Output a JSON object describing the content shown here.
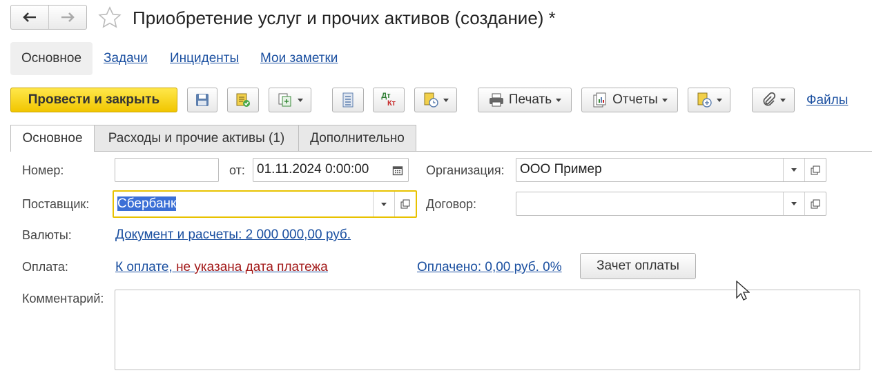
{
  "window": {
    "title": "Приобретение услуг и прочих активов (создание) *"
  },
  "nav": {
    "back_icon": "arrow-left-icon",
    "forward_icon": "arrow-right-icon",
    "favorite_icon": "star-icon"
  },
  "sections": [
    "Основное",
    "Задачи",
    "Инциденты",
    "Мои заметки"
  ],
  "toolbar": {
    "post_close_label": "Провести и закрыть",
    "print_label": "Печать",
    "reports_label": "Отчеты",
    "files_label": "Файлы",
    "dt_label": "Дт",
    "kt_label": "Кт"
  },
  "tabs": [
    "Основное",
    "Расходы и прочие активы (1)",
    "Дополнительно"
  ],
  "form": {
    "number_label": "Номер:",
    "number_value": "",
    "date_label": "от:",
    "date_value": "01.11.2024  0:00:00",
    "org_label": "Организация:",
    "org_value": "ООО Пример",
    "supplier_label": "Поставщик:",
    "supplier_value": "Сбербанк",
    "contract_label": "Договор:",
    "contract_value": "",
    "currency_label": "Валюты:",
    "currency_link": "Документ и расчеты: 2 000 000,00 руб.",
    "payment_label": "Оплата:",
    "payment_link_prefix": "К оплате, ",
    "payment_link_warning": "не указана дата платежа",
    "paid_link": "Оплачено: 0,00 руб. 0%",
    "offset_button": "Зачет оплаты",
    "comment_label": "Комментарий:",
    "comment_value": ""
  },
  "colors": {
    "primary_button": "#f5d20a",
    "link": "#1a4fa0",
    "warning": "#a21818",
    "focus_border": "#e8c200"
  }
}
